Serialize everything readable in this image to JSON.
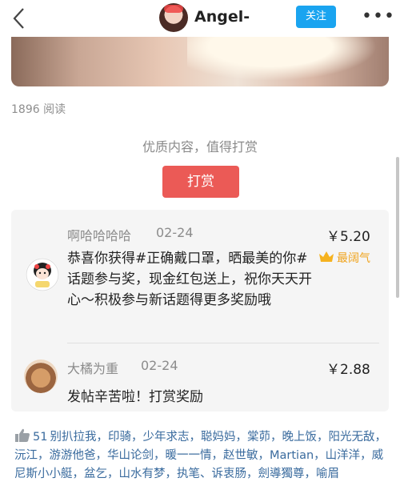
{
  "header": {
    "username": "Angel-",
    "follow_label": "关注",
    "more_label": "•••"
  },
  "post": {
    "read_count": "1896 阅读",
    "quality_text": "优质内容，值得打赏",
    "reward_label": "打赏"
  },
  "rewards": [
    {
      "name": "啊哈哈哈哈",
      "date": "02-24",
      "amount": "￥5.20",
      "badge": "最阔气",
      "message": "恭喜你获得#正确戴口罩，晒最美的你#话题参与奖，现金红包送上，祝你天天开心～积极参与新话题得更多奖励哦"
    },
    {
      "name": "大橘为重",
      "date": "02-24",
      "amount": "￥2.88",
      "message": "发帖辛苦啦！打赏奖励"
    }
  ],
  "likes": {
    "count": "51",
    "names": [
      "别扒拉我",
      "印骑",
      "少年求志",
      "聪妈妈",
      "棠茆",
      "晚上饭",
      "阳光无敌",
      "沅江",
      "游游他爸",
      "华山论剑",
      "暖一一情",
      "赵世敏",
      "Martian",
      "山洋洋",
      "威尼斯小小艇",
      "盆乞",
      "山水有梦",
      "执笔、诉衷肠",
      "劍導獨尊",
      "喻眉"
    ]
  },
  "colors": {
    "follow": "#1aa4f0",
    "reward_button": "#eb5a56",
    "link": "#3a6b9e",
    "badge": "#f0a31b"
  }
}
